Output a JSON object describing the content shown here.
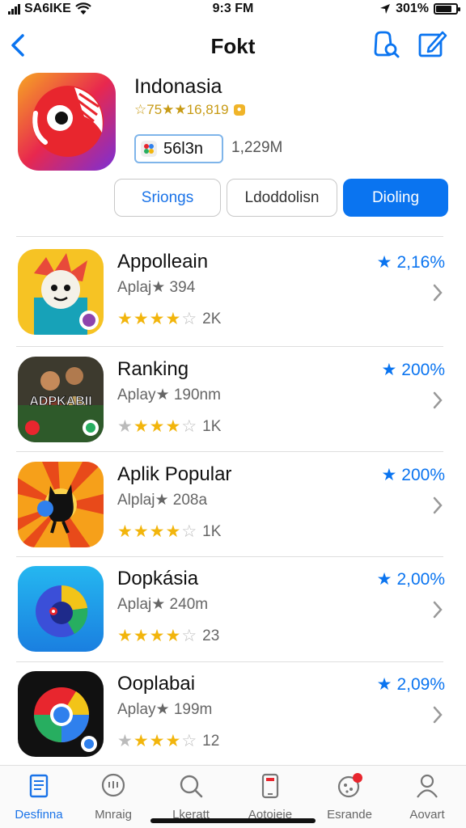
{
  "status": {
    "carrier": "SA6IKE",
    "time": "9:3 FM",
    "battery": "301%",
    "battery_level": 0.8
  },
  "nav": {
    "title": "Fokt"
  },
  "hero": {
    "title": "Indonasia",
    "rating": "☆75★★16,819",
    "chip_label": "56l3n",
    "size": "1,229M"
  },
  "segments": [
    {
      "label": "Sriongs"
    },
    {
      "label": "Ldoddolisn"
    },
    {
      "label": "Dioling"
    }
  ],
  "apps": [
    {
      "title": "Appolleain",
      "meta": "Aplaj★ 394",
      "stars_full": 4,
      "stars_half": true,
      "count": "2K",
      "rank": "2,16%"
    },
    {
      "title": "Ranking",
      "meta": "Aplay★ 190nm",
      "stars_full": 3,
      "stars_half": true,
      "count": "1K",
      "rank": "200%"
    },
    {
      "title": "Aplik Popular",
      "meta": "Alplaj★ 208a",
      "stars_full": 4,
      "stars_half": true,
      "count": "1K",
      "rank": "200%"
    },
    {
      "title": "Dopkásia",
      "meta": "Aplaj★ 240m",
      "stars_full": 4,
      "stars_half": true,
      "count": "23",
      "rank": "2,00%"
    },
    {
      "title": "Ooplabai",
      "meta": "Aplay★ 199m",
      "stars_full": 3,
      "stars_half": true,
      "count": "12",
      "rank": "2,09%"
    }
  ],
  "app_icon_text": "ADPKABII",
  "tabs": [
    {
      "label": "Desfinna",
      "icon": "document-icon"
    },
    {
      "label": "Mnraig",
      "icon": "chat-icon"
    },
    {
      "label": "Lkeratt",
      "icon": "search-icon"
    },
    {
      "label": "Aotoieie",
      "icon": "phone-icon"
    },
    {
      "label": "Esrande",
      "icon": "game-icon"
    },
    {
      "label": "Aovart",
      "icon": "person-icon"
    }
  ],
  "colors": {
    "accent": "#0a74f0",
    "star": "#f2b50c"
  }
}
